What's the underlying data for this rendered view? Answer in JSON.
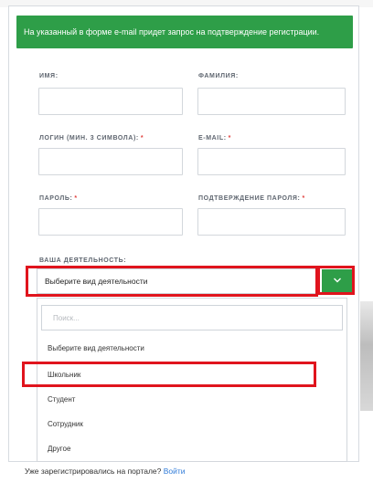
{
  "alert": {
    "text": "На указанный в форме e-mail придет запрос на подтверждение регистрации."
  },
  "fields": {
    "first_name_label": "ИМЯ:",
    "last_name_label": "ФАМИЛИЯ:",
    "login_label": "ЛОГИН (МИН. 3 СИМВОЛА):",
    "email_label": "E-MAIL:",
    "password_label": "ПАРОЛЬ:",
    "password_confirm_label": "ПОДТВЕРЖДЕНИЕ ПАРОЛЯ:",
    "required_mark": "*"
  },
  "activity": {
    "label": "ВАША ДЕЯТЕЛЬНОСТЬ:",
    "selected": "Выберите вид деятельности",
    "toggle_icon": "chevron-down-icon",
    "search_placeholder": "Поиск...",
    "options": [
      "Выберите вид деятельности",
      "Школьник",
      "Студент",
      "Сотрудник",
      "Другое"
    ]
  },
  "footer": {
    "text": "Уже зарегистрировались на портале?",
    "login_link": "Войти"
  },
  "colors": {
    "accent_green": "#2e9e48",
    "highlight_red": "#e0141d",
    "link_blue": "#2f7bd8"
  }
}
